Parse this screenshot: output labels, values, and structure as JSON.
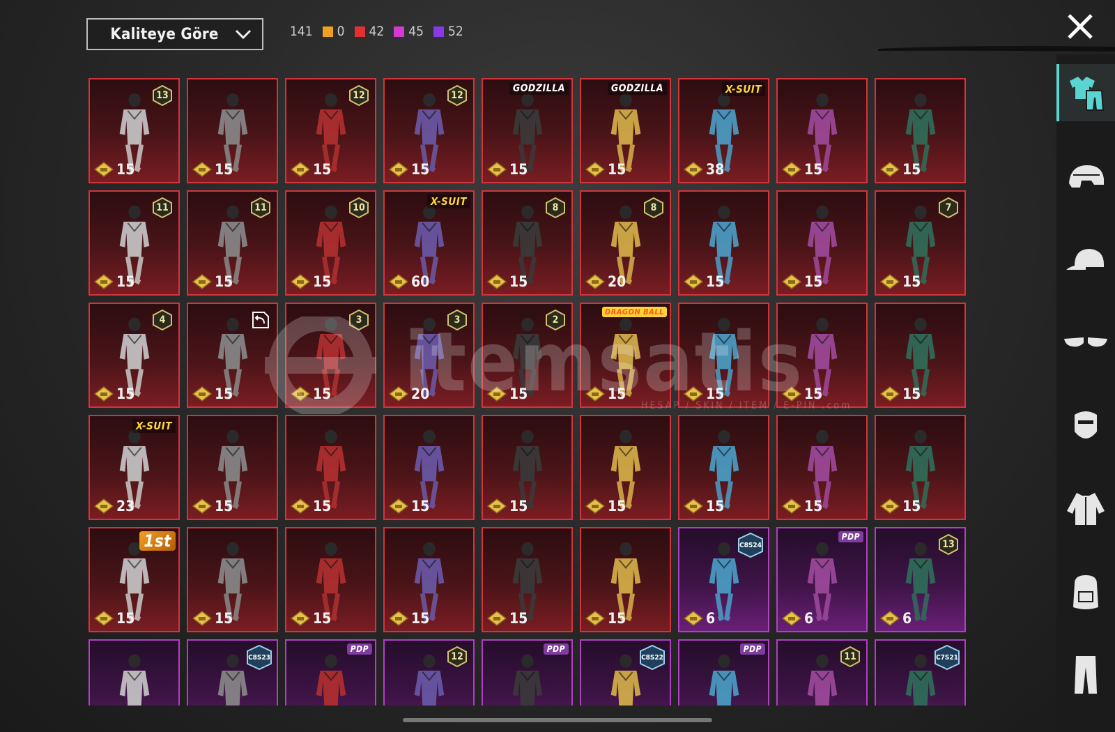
{
  "toolbar": {
    "sort_label": "Kaliteye Göre",
    "total_count": "141",
    "rarity_counts": [
      {
        "color": "#f0a020",
        "value": "0"
      },
      {
        "color": "#e53030",
        "value": "42"
      },
      {
        "color": "#d53ad0",
        "value": "45"
      },
      {
        "color": "#8a38e8",
        "value": "52"
      }
    ]
  },
  "watermark": {
    "brand": "itemsatis",
    "tagline": "HESAP / SKIN / ITEM / E-PIN .com"
  },
  "sidebar": {
    "items": [
      {
        "icon": "outfit-icon",
        "active": true
      },
      {
        "icon": "helmet-icon",
        "active": false
      },
      {
        "icon": "cap-icon",
        "active": false
      },
      {
        "icon": "glasses-icon",
        "active": false
      },
      {
        "icon": "mask-icon",
        "active": false
      },
      {
        "icon": "jacket-icon",
        "active": false
      },
      {
        "icon": "backpack-icon",
        "active": false
      },
      {
        "icon": "pants-icon",
        "active": false
      }
    ]
  },
  "items": [
    {
      "price": "15",
      "level": "13",
      "rarity": "red"
    },
    {
      "price": "15",
      "rarity": "red"
    },
    {
      "price": "15",
      "level": "12",
      "rarity": "red"
    },
    {
      "price": "15",
      "level": "12",
      "rarity": "red"
    },
    {
      "price": "15",
      "tag": "GODZILLA",
      "tag_type": "godzilla",
      "rarity": "red"
    },
    {
      "price": "15",
      "tag": "GODZILLA",
      "tag_type": "godzilla",
      "rarity": "red"
    },
    {
      "price": "38",
      "tag": "X-SUIT",
      "tag_type": "xsuit",
      "rarity": "red"
    },
    {
      "price": "15",
      "rarity": "red"
    },
    {
      "price": "15",
      "rarity": "red"
    },
    {
      "price": "15",
      "level": "11",
      "rarity": "red"
    },
    {
      "price": "15",
      "level": "11",
      "rarity": "red"
    },
    {
      "price": "15",
      "level": "10",
      "rarity": "red"
    },
    {
      "price": "60",
      "tag": "X-SUIT",
      "tag_type": "xsuit",
      "rarity": "red"
    },
    {
      "price": "15",
      "level": "8",
      "rarity": "red"
    },
    {
      "price": "20",
      "level": "8",
      "rarity": "red"
    },
    {
      "price": "15",
      "rarity": "red"
    },
    {
      "price": "15",
      "rarity": "red"
    },
    {
      "price": "15",
      "level": "7",
      "rarity": "red"
    },
    {
      "price": "15",
      "level": "4",
      "rarity": "red"
    },
    {
      "price": "15",
      "special": "back",
      "rarity": "red"
    },
    {
      "price": "15",
      "level": "3",
      "rarity": "red"
    },
    {
      "price": "20",
      "level": "3",
      "rarity": "red"
    },
    {
      "price": "15",
      "level": "2",
      "rarity": "red"
    },
    {
      "price": "15",
      "tag": "DRAGON BALL",
      "tag_type": "dragon",
      "rarity": "red"
    },
    {
      "price": "15",
      "rarity": "red"
    },
    {
      "price": "15",
      "rarity": "red"
    },
    {
      "price": "15",
      "rarity": "red"
    },
    {
      "price": "23",
      "tag": "X-SUIT",
      "tag_type": "xsuit",
      "rarity": "red"
    },
    {
      "price": "15",
      "rarity": "red"
    },
    {
      "price": "15",
      "rarity": "red"
    },
    {
      "price": "15",
      "rarity": "red"
    },
    {
      "price": "15",
      "rarity": "red"
    },
    {
      "price": "15",
      "rarity": "red"
    },
    {
      "price": "15",
      "rarity": "red"
    },
    {
      "price": "15",
      "rarity": "red"
    },
    {
      "price": "15",
      "rarity": "red"
    },
    {
      "price": "15",
      "tag": "1st",
      "tag_type": "first",
      "rarity": "red"
    },
    {
      "price": "15",
      "rarity": "red"
    },
    {
      "price": "15",
      "rarity": "red"
    },
    {
      "price": "15",
      "rarity": "red"
    },
    {
      "price": "15",
      "rarity": "red"
    },
    {
      "price": "15",
      "rarity": "red"
    },
    {
      "price": "6",
      "hex": "C8S24",
      "rarity": "purple"
    },
    {
      "price": "6",
      "tag": "PDP",
      "tag_type": "pdp",
      "rarity": "purple"
    },
    {
      "price": "6",
      "level": "13",
      "rarity": "purple"
    },
    {
      "rarity": "purple"
    },
    {
      "hex": "C8S23",
      "rarity": "purple"
    },
    {
      "tag": "PDP",
      "tag_type": "pdp",
      "rarity": "purple"
    },
    {
      "level": "12",
      "rarity": "purple"
    },
    {
      "tag": "PDP",
      "tag_type": "pdp",
      "rarity": "purple"
    },
    {
      "hex": "C8S22",
      "rarity": "purple"
    },
    {
      "tag": "PDP",
      "tag_type": "pdp",
      "rarity": "purple"
    },
    {
      "level": "11",
      "rarity": "purple"
    },
    {
      "hex": "C7S21",
      "rarity": "purple"
    }
  ]
}
